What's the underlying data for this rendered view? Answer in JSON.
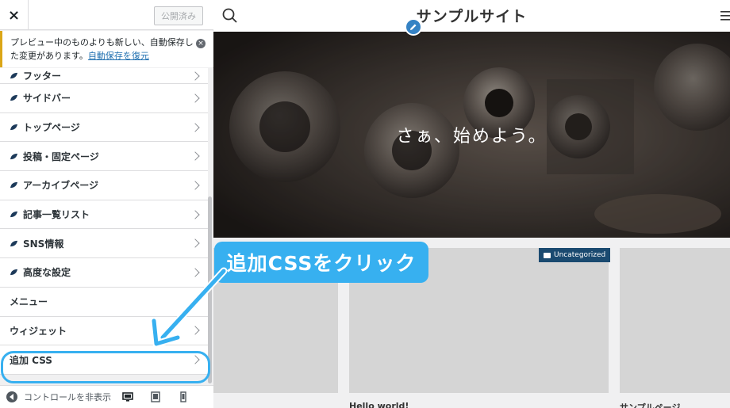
{
  "customizer": {
    "close_glyph": "×",
    "publish_label": "公開済み",
    "notice": {
      "text": "プレビュー中のものよりも新しい、自動保存した変更があります。",
      "link": "自動保存を復元",
      "close_glyph": "×"
    },
    "menu": [
      {
        "label": "フッター",
        "icon": "leaf-icon"
      },
      {
        "label": "サイドバー",
        "icon": "leaf-icon"
      },
      {
        "label": "トップページ",
        "icon": "leaf-icon"
      },
      {
        "label": "投稿・固定ページ",
        "icon": "leaf-icon"
      },
      {
        "label": "アーカイブページ",
        "icon": "leaf-icon"
      },
      {
        "label": "記事一覧リスト",
        "icon": "leaf-icon"
      },
      {
        "label": "SNS情報",
        "icon": "leaf-icon"
      },
      {
        "label": "高度な設定",
        "icon": "leaf-icon"
      },
      {
        "label": "メニュー"
      },
      {
        "label": "ウィジェット"
      },
      {
        "label": "追加 CSS"
      }
    ],
    "footer": {
      "hide_controls": "コントロールを非表示"
    }
  },
  "preview": {
    "site_title": "サンプルサイト",
    "hero_text": "さぁ、始めよう。",
    "category_badge": "Uncategorized",
    "card1_title": "Hello world!",
    "card2_title": "サンプルページ"
  },
  "annotation": {
    "callout": "追加CSSをクリック"
  },
  "colors": {
    "accent": "#37b0f0",
    "notice_border": "#dba617",
    "link": "#2271b1",
    "badge": "#1a4a70"
  }
}
